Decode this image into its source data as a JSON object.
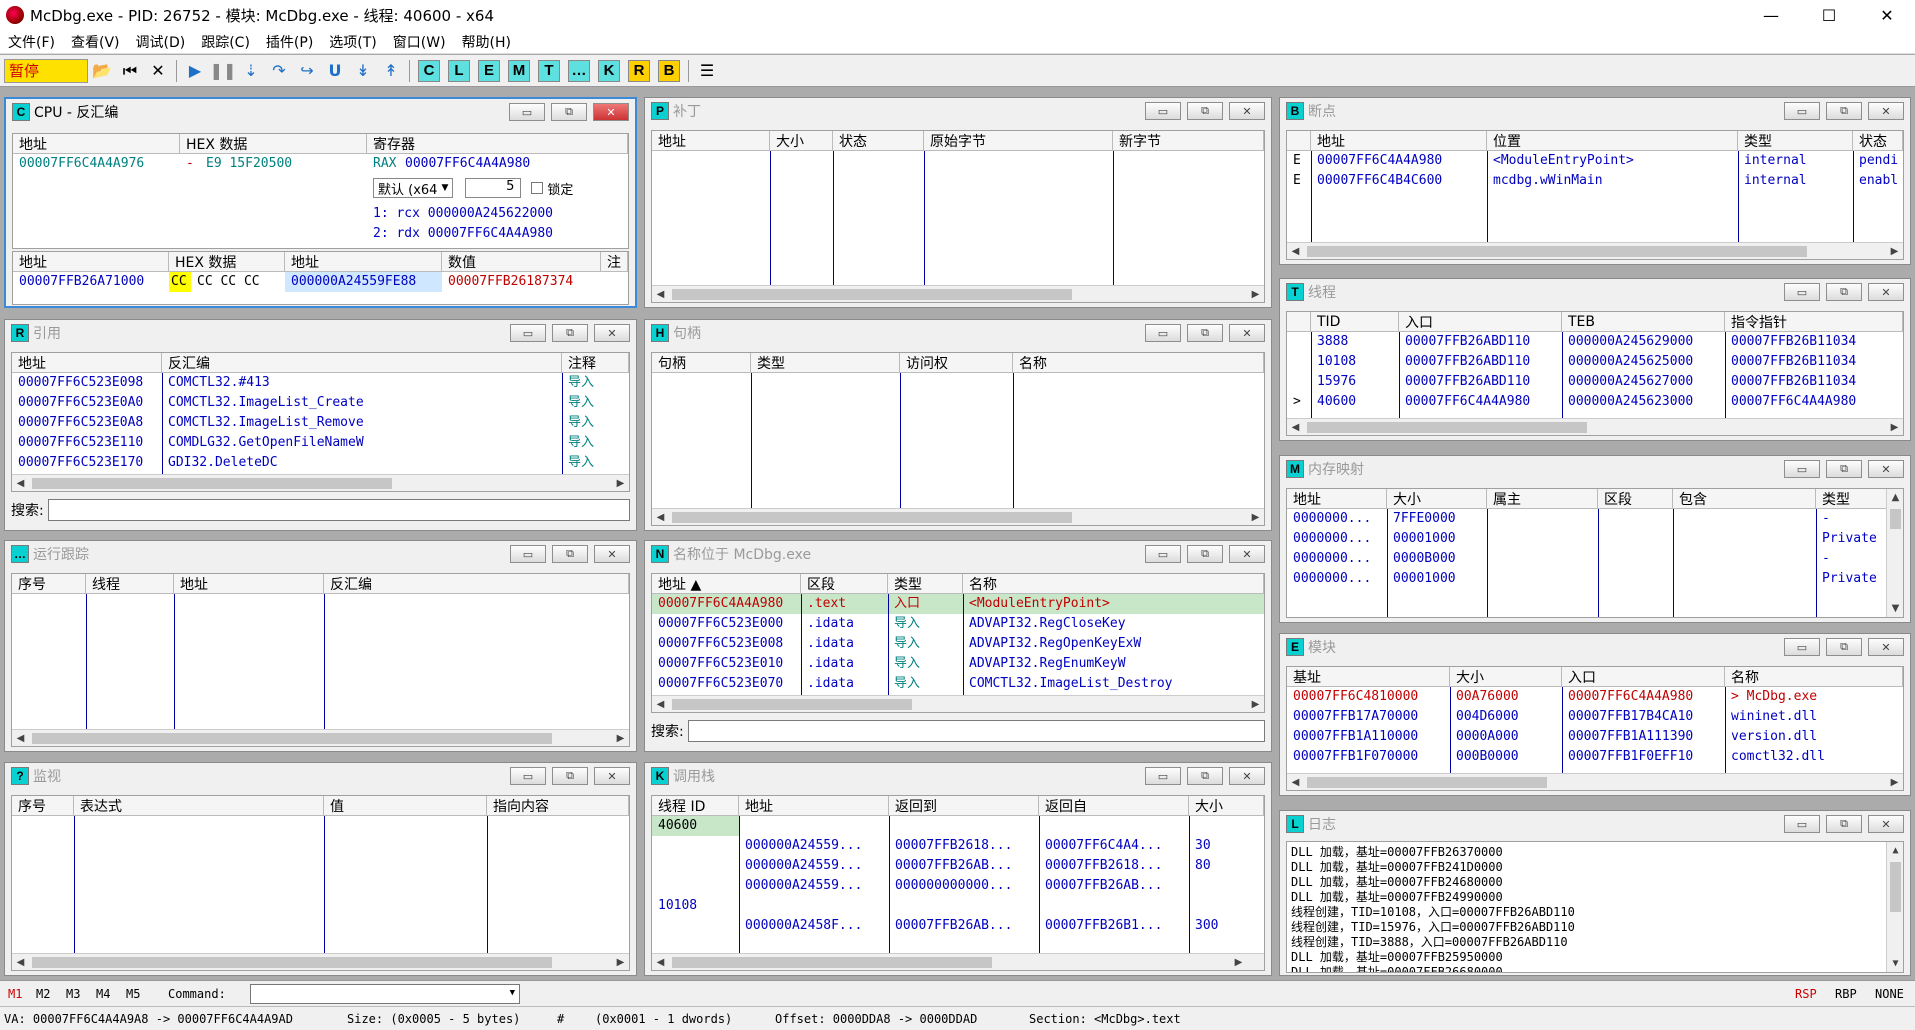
{
  "window": {
    "title": "McDbg.exe - PID: 26752 - 模块: McDbg.exe - 线程: 40600 - x64",
    "min": "—",
    "max": "☐",
    "close": "✕"
  },
  "menu": [
    "文件(F)",
    "查看(V)",
    "调试(D)",
    "跟踪(C)",
    "插件(P)",
    "选项(T)",
    "窗口(W)",
    "帮助(H)"
  ],
  "toolbar": {
    "status": "暂停",
    "letters": [
      "C",
      "L",
      "E",
      "M",
      "T",
      "…",
      "K",
      "R",
      "B"
    ]
  },
  "cpu": {
    "badge": "C",
    "title": "CPU - 反汇编",
    "hex_headers": [
      "地址",
      "HEX 数据",
      "寄存器"
    ],
    "hex_row": {
      "addr": "00007FF6C4A4A976",
      "arrow": "-",
      "bytes": "E9 15F20500",
      "rax_label": "RAX",
      "rax": "00007FF6C4A4A980"
    },
    "default_label": "默认 (x64",
    "lock_label": "锁定",
    "count": "5",
    "regs": [
      "1: rcx 000000A245622000",
      "2: rdx 00007FF6C4A4A980"
    ],
    "dump_headers": [
      "地址",
      "HEX 数据",
      "地址",
      "数值",
      "注"
    ],
    "dump_row": {
      "addr": "00007FFB26A71000",
      "b1": "CC",
      "rest": "CC CC CC",
      "saddr": "000000A24559FE88",
      "sval": "00007FFB26187374"
    }
  },
  "patch": {
    "badge": "P",
    "title": "补丁",
    "headers": [
      "地址",
      "大小",
      "状态",
      "原始字节",
      "新字节"
    ]
  },
  "breakpoints": {
    "badge": "B",
    "title": "断点",
    "headers": [
      "地址",
      "位置",
      "类型",
      "状态"
    ],
    "rows": [
      [
        "E",
        "00007FF6C4A4A980",
        "<ModuleEntryPoint>",
        "internal",
        "pendi"
      ],
      [
        "E",
        "00007FF6C4B4C600",
        "mcdbg.wWinMain",
        "internal",
        "enabl"
      ]
    ]
  },
  "refs": {
    "badge": "R",
    "title": "引用",
    "headers": [
      "地址",
      "反汇编",
      "注释"
    ],
    "rows": [
      [
        "00007FF6C523E098",
        "COMCTL32.#413",
        "导入"
      ],
      [
        "00007FF6C523E0A0",
        "COMCTL32.ImageList_Create",
        "导入"
      ],
      [
        "00007FF6C523E0A8",
        "COMCTL32.ImageList_Remove",
        "导入"
      ],
      [
        "00007FF6C523E110",
        "COMDLG32.GetOpenFileNameW",
        "导入"
      ],
      [
        "00007FF6C523E170",
        "GDI32.DeleteDC",
        "导入"
      ]
    ],
    "search_label": "搜索:"
  },
  "handles": {
    "badge": "H",
    "title": "句柄",
    "headers": [
      "句柄",
      "类型",
      "访问权",
      "名称"
    ]
  },
  "threads": {
    "badge": "T",
    "title": "线程",
    "headers": [
      "TID",
      "入口",
      "TEB",
      "指令指针"
    ],
    "rows": [
      [
        "",
        "3888",
        "00007FFB26ABD110",
        "000000A245629000",
        "00007FFB26B11034"
      ],
      [
        "",
        "10108",
        "00007FFB26ABD110",
        "000000A245625000",
        "00007FFB26B11034"
      ],
      [
        "",
        "15976",
        "00007FFB26ABD110",
        "000000A245627000",
        "00007FFB26B11034"
      ],
      [
        ">",
        "40600",
        "00007FF6C4A4A980",
        "000000A245623000",
        "00007FF6C4A4A980"
      ]
    ]
  },
  "trace": {
    "badge": "…",
    "title": "运行跟踪",
    "headers": [
      "序号",
      "线程",
      "地址",
      "反汇编"
    ]
  },
  "names": {
    "badge": "N",
    "title": "名称位于 McDbg.exe",
    "headers": [
      "地址 ▲",
      "区段",
      "类型",
      "名称"
    ],
    "rows": [
      [
        "00007FF6C4A4A980",
        ".text",
        "入口",
        "<ModuleEntryPoint>"
      ],
      [
        "00007FF6C523E000",
        ".idata",
        "导入",
        "ADVAPI32.RegCloseKey"
      ],
      [
        "00007FF6C523E008",
        ".idata",
        "导入",
        "ADVAPI32.RegOpenKeyExW"
      ],
      [
        "00007FF6C523E010",
        ".idata",
        "导入",
        "ADVAPI32.RegEnumKeyW"
      ],
      [
        "00007FF6C523E070",
        ".idata",
        "导入",
        "COMCTL32.ImageList_Destroy"
      ]
    ],
    "search_label": "搜索:"
  },
  "memmap": {
    "badge": "M",
    "title": "内存映射",
    "headers": [
      "地址",
      "大小",
      "属主",
      "区段",
      "包含",
      "类型"
    ],
    "rows": [
      [
        "0000000...",
        "7FFE0000",
        "-"
      ],
      [
        "0000000...",
        "00001000",
        "Private"
      ],
      [
        "0000000...",
        "0000B000",
        "-"
      ],
      [
        "0000000...",
        "00001000",
        "Private"
      ]
    ]
  },
  "modules": {
    "badge": "E",
    "title": "模块",
    "headers": [
      "基址",
      "大小",
      "入口",
      "名称"
    ],
    "rows": [
      [
        "00007FF6C4810000",
        "00A76000",
        "00007FF6C4A4A980",
        "> McDbg.exe"
      ],
      [
        "00007FFB17A70000",
        "004D6000",
        "00007FFB17B4CA10",
        "wininet.dll"
      ],
      [
        "00007FFB1A110000",
        "0000A000",
        "00007FFB1A111390",
        "version.dll"
      ],
      [
        "00007FFB1F070000",
        "000B0000",
        "00007FFB1F0EFF10",
        "comctl32.dll"
      ]
    ]
  },
  "watch": {
    "badge": "?",
    "title": "监视",
    "headers": [
      "序号",
      "表达式",
      "值",
      "指向内容"
    ]
  },
  "callstack": {
    "badge": "K",
    "title": "调用栈",
    "headers": [
      "线程 ID",
      "地址",
      "返回到",
      "返回自",
      "大小"
    ],
    "rows": [
      [
        "40600",
        "",
        "",
        "",
        ""
      ],
      [
        "",
        "000000A24559...",
        "00007FFB2618...",
        "00007FF6C4A4...",
        "30"
      ],
      [
        "",
        "000000A24559...",
        "00007FFB26AB...",
        "00007FFB2618...",
        "80"
      ],
      [
        "",
        "000000A24559...",
        "000000000000...",
        "00007FFB26AB...",
        ""
      ],
      [
        "10108",
        "",
        "",
        "",
        ""
      ],
      [
        "",
        "000000A2458F...",
        "00007FFB26AB...",
        "00007FFB26B1...",
        "300"
      ]
    ]
  },
  "log": {
    "badge": "L",
    "title": "日志",
    "lines": [
      "DLL 加载，基址=00007FFB26370000",
      "DLL 加载，基址=00007FFB241D0000",
      "DLL 加载，基址=00007FFB24680000",
      "DLL 加载，基址=00007FFB24990000",
      "线程创建，TID=10108，入口=00007FFB26ABD110",
      "线程创建，TID=15976，入口=00007FFB26ABD110",
      "线程创建，TID=3888，入口=00007FFB26ABD110",
      "DLL 加载，基址=00007FFB25950000",
      "DLL 加载，基址=00007FFB26680000"
    ]
  },
  "status": {
    "m_tabs": [
      "M1",
      "M2",
      "M3",
      "M4",
      "M5"
    ],
    "command_label": "Command:",
    "regs": [
      "RSP",
      "RBP",
      "NONE"
    ],
    "va": "VA: 00007FF6C4A4A9A8 -> 00007FF6C4A4A9AD",
    "size": "Size: (0x0005 - 5 bytes)",
    "hash": "#",
    "dwords": "(0x0001 - 1 dwords)",
    "offset": "Offset: 0000DDA8 -> 0000DDAD",
    "section": "Section: <McDbg>.text"
  },
  "colors": {
    "accent": "#3a8ad7",
    "badge": "#0ad1d1",
    "paused_bg": "#ffe100",
    "paused_fg": "#d00000"
  }
}
